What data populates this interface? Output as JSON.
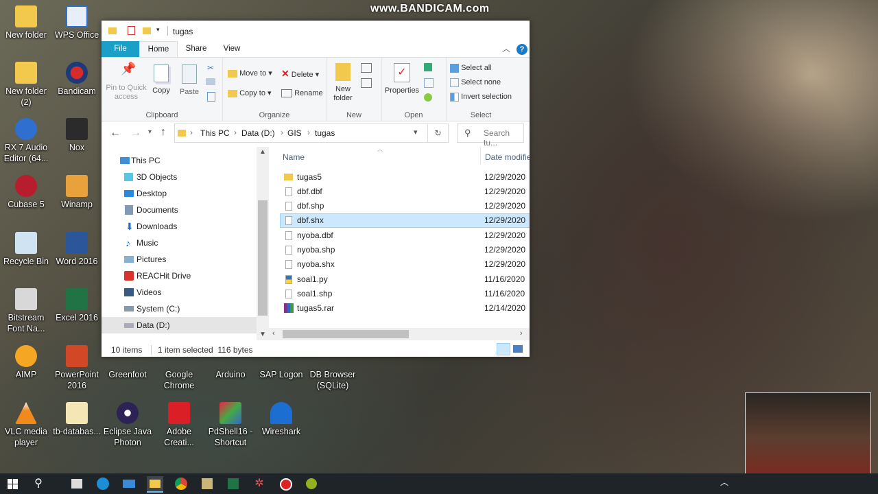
{
  "watermark": "www.BANDICAM.com",
  "desktop": {
    "icons": [
      {
        "label": "New folder"
      },
      {
        "label": "WPS Office"
      },
      {
        "label": "New folder (2)"
      },
      {
        "label": "Bandicam"
      },
      {
        "label": "RX 7 Audio Editor (64..."
      },
      {
        "label": "Nox"
      },
      {
        "label": "Cubase 5"
      },
      {
        "label": "Winamp"
      },
      {
        "label": "Recycle Bin"
      },
      {
        "label": "Word 2016"
      },
      {
        "label": "Bitstream Font Na..."
      },
      {
        "label": "Excel 2016"
      },
      {
        "label": "AIMP"
      },
      {
        "label": "PowerPoint 2016"
      },
      {
        "label": "Greenfoot"
      },
      {
        "label": "Google Chrome"
      },
      {
        "label": "Arduino"
      },
      {
        "label": "SAP Logon"
      },
      {
        "label": "DB Browser (SQLite)"
      },
      {
        "label": "VLC media player"
      },
      {
        "label": "tb-databas..."
      },
      {
        "label": "Eclipse Java Photon"
      },
      {
        "label": "Adobe Creati..."
      },
      {
        "label": "PdShell16 - Shortcut"
      },
      {
        "label": "Wireshark"
      }
    ]
  },
  "explorer": {
    "title": "tugas",
    "tabs": {
      "file": "File",
      "home": "Home",
      "share": "Share",
      "view": "View"
    },
    "ribbon": {
      "clipboard": {
        "pin": "Pin to Quick access",
        "copy": "Copy",
        "paste": "Paste",
        "label": "Clipboard"
      },
      "organize": {
        "move_to": "Move to",
        "copy_to": "Copy to",
        "delete": "Delete",
        "rename": "Rename",
        "label": "Organize"
      },
      "new": {
        "new_folder": "New folder",
        "label": "New"
      },
      "open": {
        "properties": "Properties",
        "label": "Open"
      },
      "select": {
        "select_all": "Select all",
        "select_none": "Select none",
        "invert": "Invert selection",
        "label": "Select"
      }
    },
    "address": {
      "crumbs": [
        "This PC",
        "Data (D:)",
        "GIS",
        "tugas"
      ],
      "search_placeholder": "Search tu..."
    },
    "nav": [
      {
        "label": "This PC",
        "icon": "computer"
      },
      {
        "label": "3D Objects",
        "icon": "cube"
      },
      {
        "label": "Desktop",
        "icon": "desktop"
      },
      {
        "label": "Documents",
        "icon": "document"
      },
      {
        "label": "Downloads",
        "icon": "download"
      },
      {
        "label": "Music",
        "icon": "music"
      },
      {
        "label": "Pictures",
        "icon": "picture"
      },
      {
        "label": "REACHit Drive",
        "icon": "reachit"
      },
      {
        "label": "Videos",
        "icon": "video"
      },
      {
        "label": "System (C:)",
        "icon": "drive"
      },
      {
        "label": "Data (D:)",
        "icon": "drive"
      }
    ],
    "columns": {
      "name": "Name",
      "date": "Date modifie"
    },
    "files": [
      {
        "name": "tugas5",
        "date": "12/29/2020",
        "type": "folder"
      },
      {
        "name": "dbf.dbf",
        "date": "12/29/2020",
        "type": "file"
      },
      {
        "name": "dbf.shp",
        "date": "12/29/2020",
        "type": "file"
      },
      {
        "name": "dbf.shx",
        "date": "12/29/2020",
        "type": "file",
        "selected": true
      },
      {
        "name": "nyoba.dbf",
        "date": "12/29/2020",
        "type": "file"
      },
      {
        "name": "nyoba.shp",
        "date": "12/29/2020",
        "type": "file"
      },
      {
        "name": "nyoba.shx",
        "date": "12/29/2020",
        "type": "file"
      },
      {
        "name": "soal1.py",
        "date": "11/16/2020",
        "type": "python"
      },
      {
        "name": "soal1.shp",
        "date": "11/16/2020",
        "type": "file"
      },
      {
        "name": "tugas5.rar",
        "date": "12/14/2020",
        "type": "rar"
      }
    ],
    "status": {
      "count": "10 items",
      "selection": "1 item selected  116 bytes"
    }
  },
  "colors": {
    "accent": "#1979ca",
    "selection": "#cce8ff",
    "file_tab": "#1aa0c8"
  }
}
